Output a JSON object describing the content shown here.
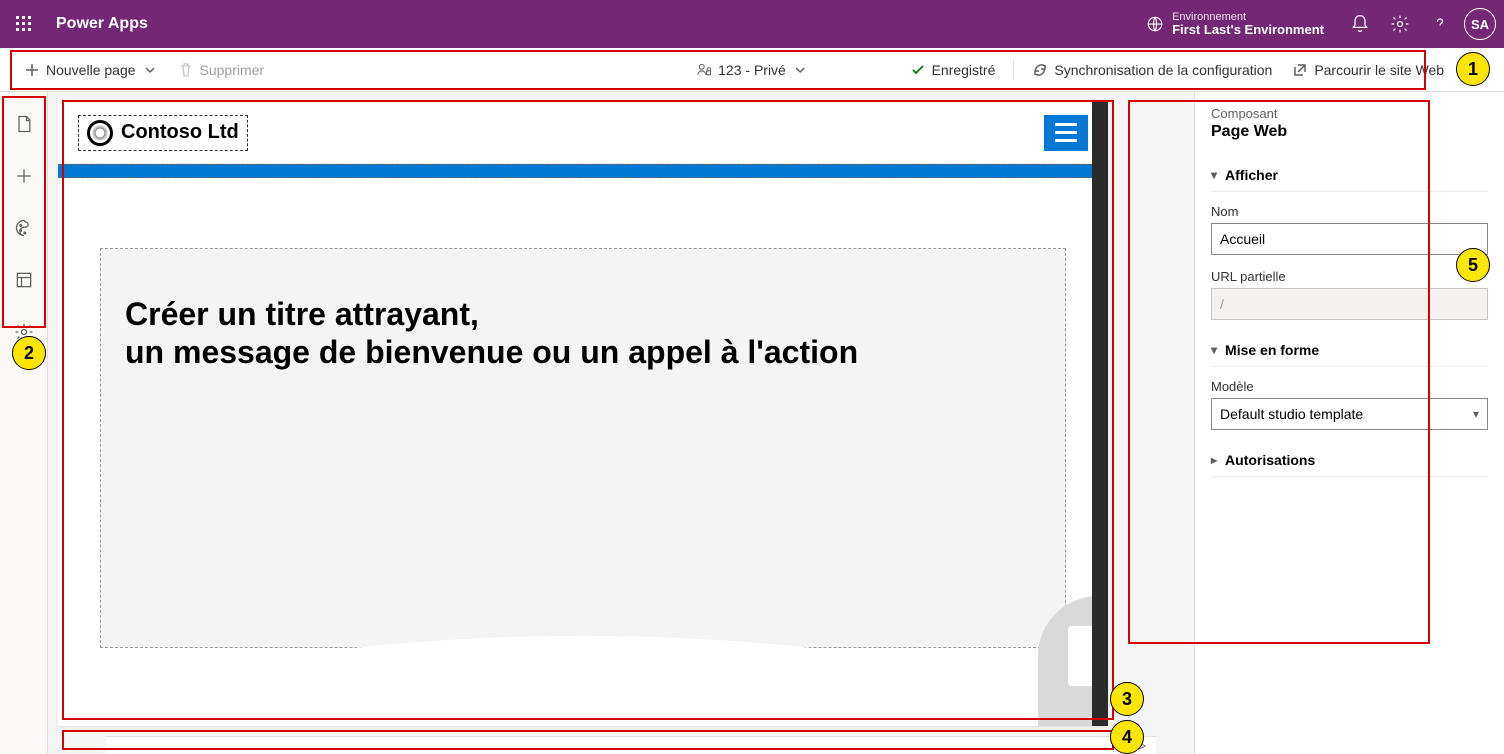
{
  "appbar": {
    "app_name": "Power Apps",
    "env_label": "Environnement",
    "env_value": "First Last's Environment",
    "avatar_initials": "SA"
  },
  "cmdbar": {
    "new_page": "Nouvelle page",
    "delete": "Supprimer",
    "visibility": "123 - Privé",
    "saved": "Enregistré",
    "sync": "Synchronisation de la configuration",
    "browse": "Parcourir le site Web"
  },
  "canvas": {
    "logo_text": "Contoso Ltd",
    "hero_title": "Créer un titre attrayant,\nun message de bienvenue ou un appel à l'action"
  },
  "panel": {
    "component_label": "Composant",
    "component_value": "Page Web",
    "section_display": "Afficher",
    "field_name_label": "Nom",
    "field_name_value": "Accueil",
    "field_url_label": "URL partielle",
    "field_url_value": "/",
    "section_format": "Mise en forme",
    "field_template_label": "Modèle",
    "field_template_value": "Default studio template",
    "section_permissions": "Autorisations"
  },
  "footer": {
    "code_symbol": "</>"
  },
  "callouts": {
    "c1": "1",
    "c2": "2",
    "c3": "3",
    "c4": "4",
    "c5": "5"
  }
}
